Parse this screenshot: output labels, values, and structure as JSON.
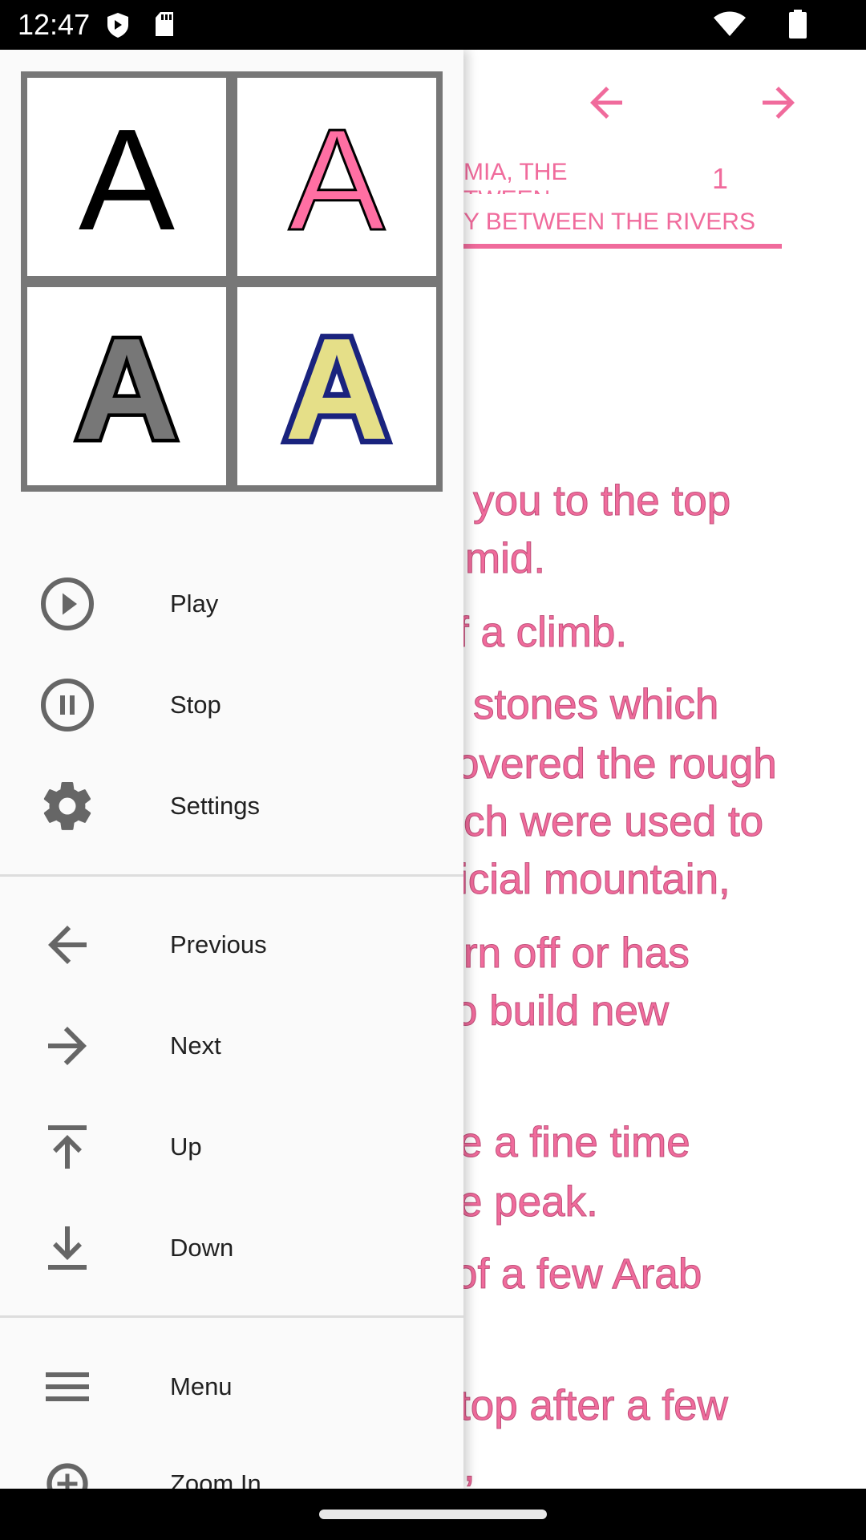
{
  "status_bar": {
    "time": "12:47",
    "icons": [
      "shield-icon",
      "sd-card-icon",
      "wifi-icon",
      "battery-icon"
    ]
  },
  "colors": {
    "accent": "#f06b9c",
    "drawer_bg": "#fafafa",
    "icon_gray": "#666666"
  },
  "toolbar": {
    "prev_icon": "arrow-left-icon",
    "next_icon": "arrow-right-icon"
  },
  "tabs": {
    "tab1_line1": "MIA, THE",
    "tab1_line2": "TWEEN",
    "tab2": "Y BETWEEN THE RIVERS",
    "tab3": "1"
  },
  "body_lines": [
    "you to the top",
    "mid.",
    "f a climb.",
    "stones which",
    "overed the rough",
    "ch were used to",
    "icial mountain,",
    "rn off or has",
    "o build new",
    "e a fine time",
    "e peak.",
    "of a few Arab",
    "top after a few",
    ","
  ],
  "drawer": {
    "style_options": [
      {
        "letter": "A",
        "style": "black"
      },
      {
        "letter": "A",
        "style": "pink-outlined"
      },
      {
        "letter": "A",
        "style": "gray-outlined"
      },
      {
        "letter": "A",
        "style": "yellow-navy-outlined"
      }
    ],
    "items": [
      {
        "label": "Play",
        "icon": "play-circle-icon"
      },
      {
        "label": "Stop",
        "icon": "pause-circle-icon"
      },
      {
        "label": "Settings",
        "icon": "gear-icon"
      },
      {
        "label": "Previous",
        "icon": "arrow-left-icon"
      },
      {
        "label": "Next",
        "icon": "arrow-right-icon"
      },
      {
        "label": "Up",
        "icon": "arrow-up-to-top-icon"
      },
      {
        "label": "Down",
        "icon": "arrow-down-to-bottom-icon"
      },
      {
        "label": "Menu",
        "icon": "hamburger-icon"
      },
      {
        "label": "Zoom In",
        "icon": "zoom-in-icon"
      }
    ]
  }
}
